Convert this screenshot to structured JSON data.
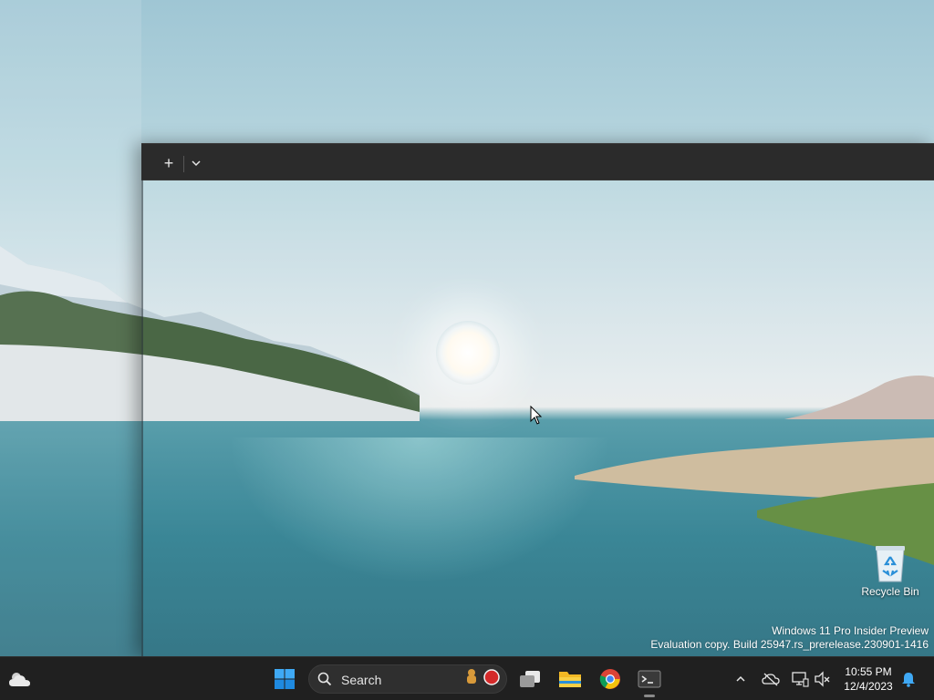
{
  "desktop": {
    "icons": [
      {
        "name": "recycle-bin",
        "label": "Recycle Bin",
        "icon": "recycle-bin-icon"
      }
    ],
    "watermark": {
      "line1": "Windows 11 Pro Insider Preview",
      "line2": "Evaluation copy. Build 25947.rs_prerelease.230901-1416"
    }
  },
  "terminal_window": {
    "new_tab_label": "+",
    "dropdown_icon": "chevron-down-icon",
    "titlebar_color": "#2b2b2b"
  },
  "taskbar": {
    "widgets_icon": "weather-cloud-icon",
    "start_icon": "windows-logo-icon",
    "search": {
      "placeholder": "Search",
      "icon": "search-icon"
    },
    "pinned": [
      {
        "name": "task-view",
        "icon": "task-view-icon"
      },
      {
        "name": "file-explorer",
        "icon": "folder-icon"
      },
      {
        "name": "chrome",
        "icon": "chrome-icon"
      },
      {
        "name": "terminal",
        "icon": "terminal-icon",
        "running": true
      }
    ],
    "tray": {
      "icons": [
        "chevron-up-icon",
        "onedrive-offline-icon",
        "network-icon",
        "volume-muted-icon"
      ],
      "time": "10:55 PM",
      "date": "12/4/2023",
      "notification_icon": "bell-icon"
    },
    "accent_color": "#0a84d8"
  }
}
